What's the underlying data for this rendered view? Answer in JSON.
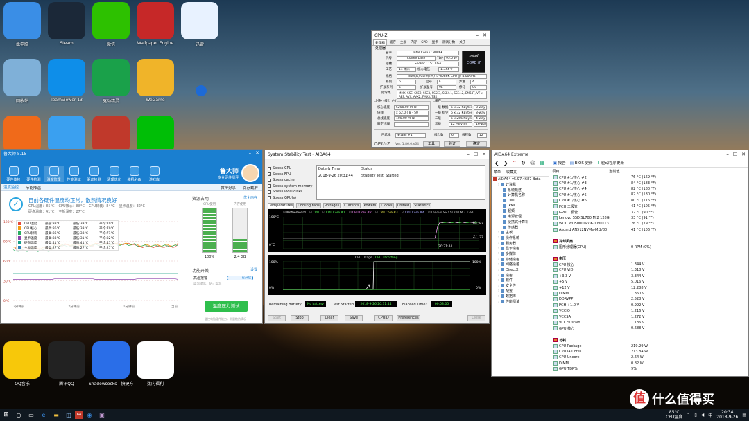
{
  "desktop": {
    "icons": [
      {
        "label": "此电脑",
        "icon": "computer-icon",
        "color": "#3a8ee6"
      },
      {
        "label": "Steam",
        "icon": "steam-icon",
        "color": "#1b2838"
      },
      {
        "label": "微信",
        "icon": "wechat-icon",
        "color": "#2dc100"
      },
      {
        "label": "Wallpaper Engine",
        "icon": "wallpaper-engine-icon",
        "color": "#c62828"
      },
      {
        "label": "迅雷",
        "icon": "xunlei-icon",
        "color": "#e8f2ff"
      },
      {
        "label": "回收站",
        "icon": "recycle-bin-icon",
        "color": "#7fb0d8"
      },
      {
        "label": "TeamViewer 13",
        "icon": "teamviewer-icon",
        "color": "#0e8ee9"
      },
      {
        "label": "驱动精灵",
        "icon": "driver-genius-icon",
        "color": "#1aa14a"
      },
      {
        "label": "WeGame",
        "icon": "wegame-icon",
        "color": "#f0b429"
      },
      {
        "label": "",
        "icon": "app-icon",
        "color": "#1d6ad6"
      },
      {
        "label": "",
        "icon": "layers-icon",
        "color": "#f06a1a"
      },
      {
        "label": "",
        "icon": "qq-browser-icon",
        "color": "#3aa0f0"
      },
      {
        "label": "",
        "icon": "aida64-icon",
        "color": "#c0392b"
      },
      {
        "label": "",
        "icon": "iqiyi-icon",
        "color": "#00be06"
      },
      {
        "label": "QQ音乐",
        "icon": "qqmusic-icon",
        "color": "#f7c80a"
      },
      {
        "label": "腾讯QQ",
        "icon": "qq-icon",
        "color": "#222"
      },
      {
        "label": "Shadowsocks - 快捷方式",
        "icon": "shadowsocks-icon",
        "color": "#2a6ee8"
      },
      {
        "label": "数内福利",
        "icon": "document-icon",
        "color": "#ffffff"
      }
    ]
  },
  "ludashi": {
    "title": "鲁大师 5.15",
    "tools": [
      "硬件体检",
      "硬件检测",
      "温度管理",
      "性能测试",
      "驱动检测",
      "清理优化",
      "装机必备",
      "游戏库"
    ],
    "brand": "鲁大师",
    "brand_sub": "专业硬件测评",
    "tabs": [
      "温度监控",
      "节能降温"
    ],
    "right_links": [
      "微博分享",
      "保存截屏"
    ],
    "status": "目前各硬件温度均正常，散热情况良好",
    "summary": [
      "CPU温度：85°C",
      "CPU核心：88°C",
      "CPU封装：84°C",
      "显卡温度：32°C",
      "硬盘温度：41°C",
      "主板温度：27°C"
    ],
    "legend": [
      {
        "name": "CPU温度",
        "cur": "最低:38°C",
        "min": "最低:33°C",
        "avg": "平均:70°C",
        "color": "#e74c3c"
      },
      {
        "name": "CPU核心",
        "cur": "最高:86°C",
        "min": "最低:33°C",
        "avg": "平均:70°C",
        "color": "#f39c12"
      },
      {
        "name": "CPU封装",
        "cur": "最高:86°C",
        "min": "最低:33°C",
        "avg": "平均:71°C",
        "color": "#27ae60"
      },
      {
        "name": "显卡温度",
        "cur": "最高:33°C",
        "min": "最低:31°C",
        "avg": "平均:32°C",
        "color": "#8e44ad"
      },
      {
        "name": "硬盘温度",
        "cur": "最高:41°C",
        "min": "最低:41°C",
        "avg": "平均:41°C",
        "color": "#16a085"
      },
      {
        "name": "主板温度",
        "cur": "最高:27°C",
        "min": "最低:27°C",
        "avg": "平均:27°C",
        "color": "#2980b9"
      }
    ],
    "yticks": [
      "120°C",
      "90°C",
      "60°C",
      "30°C",
      "0°C"
    ],
    "xticks": [
      "3分钟前",
      "2分钟前",
      "1分钟前",
      "当前"
    ],
    "resource_title": "资源占用",
    "resource_link": "优化内存",
    "cpu_label": "CPU使用",
    "mem_label": "内存使用",
    "cpu_value": "100%",
    "mem_value": "2.4 GB",
    "cpu_fill": 1.0,
    "mem_fill": 0.3,
    "func_title": "功能开关",
    "func_link": "设置",
    "alarm_label": "高温报警",
    "alarm_sub": "高温提示，防止高温",
    "alarm_state": "已开启",
    "stress_button": "温度压力测试",
    "footer": "监控电脑硬件能力，测量散热情况"
  },
  "aida_stress": {
    "title": "System Stability Test - AIDA64",
    "checks": [
      {
        "l": "Stress CPU",
        "c": false
      },
      {
        "l": "Stress FPU",
        "c": true
      },
      {
        "l": "Stress cache",
        "c": false
      },
      {
        "l": "Stress system memory",
        "c": false
      },
      {
        "l": "Stress local disks",
        "c": false
      },
      {
        "l": "Stress GPU(s)",
        "c": false
      }
    ],
    "col_date": "Date & Time",
    "col_status": "Status",
    "log_date": "2018-9-26 20:31:44",
    "log_status": "Stability Test: Started",
    "tabs": [
      "Temperatures",
      "Cooling Fans",
      "Voltages",
      "Currents",
      "Powers",
      "Clocks",
      "Unified",
      "Statistics"
    ],
    "temp_legend": [
      "Motherboard",
      "CPU",
      "CPU Core #1",
      "CPU Core #2",
      "CPU Core #3",
      "CPU Core #4",
      "Lenovo SSD SL700 M.2 128G"
    ],
    "temp_top": "100°C",
    "temp_bottom": "0°C",
    "temp_time": "20:31:44",
    "temp_vals": [
      "83",
      "82",
      "27",
      "33"
    ],
    "usage_title": "CPU Usage",
    "throttle_title": "CPU Throttling",
    "usage_top": "100%",
    "usage_bottom": "0%",
    "usage_right_top": "100%",
    "usage_right_bottom": "0%",
    "battery_label": "Remaining Battery:",
    "battery_value": "No battery",
    "started_label": "Test Started:",
    "started_value": "2018-9-26 20:31:44",
    "elapsed_label": "Elapsed Time:",
    "elapsed_value": "00:03:05",
    "buttons": [
      "Start",
      "Stop",
      "Clear",
      "Save",
      "CPUID",
      "Preferences",
      "Close"
    ]
  },
  "cpuz": {
    "title": "CPU-Z",
    "tabs": [
      "处理器",
      "缓存",
      "主板",
      "内存",
      "SPD",
      "显卡",
      "测试分数",
      "关于"
    ],
    "section": "处理器",
    "name_l": "名字",
    "name": "Intel Core i7 8086K",
    "code_l": "代号",
    "code": "Coffee Lake",
    "tdp_l": "TDP",
    "tdp": "95.0 W",
    "socket_l": "插槽",
    "socket": "Socket 1151 LGA",
    "tech_l": "工艺",
    "tech": "14 纳米",
    "volt_l": "核心电压",
    "volt": "1.344 V",
    "spec_l": "规格",
    "spec": "Intel(R) Core(TM) i7-8086K CPU @ 4.00GHz",
    "family_l": "系列",
    "family": "6",
    "model_l": "型号",
    "model": "E",
    "step_l": "步进",
    "step": "A",
    "extfam_l": "扩展系列",
    "extfam": "6",
    "extmodel_l": "扩展型号",
    "extmodel": "9E",
    "rev_l": "修订",
    "rev": "U0",
    "inst_l": "指令集",
    "inst": "MMX, SSE, SSE2, SSE3, SSSE3, SSE4.1, SSE4.2, EM64T, VT-x, AES, AVX, AVX2, FMA3, TSX",
    "clock_title": "时钟 (核心 #0)",
    "cache_title": "缓存",
    "core_speed_l": "核心速度",
    "core_speed": "5200.00 MHz",
    "mult_l": "倍频",
    "mult": "x 52.0 ( 8 - 50 )",
    "bus_l": "总线速度",
    "bus": "100.00 MHz",
    "fsb_l": "额定 FSB",
    "fsb": "",
    "l1d_l": "一级 数据",
    "l1d": "6 x 32 KBytes",
    "l1d_w": "8-way",
    "l1i_l": "一级 指令",
    "l1i": "6 x 32 KBytes",
    "l1i_w": "8-way",
    "l2_l": "二级",
    "l2": "6 x 256 KBytes",
    "l2_w": "4-way",
    "l3_l": "三级",
    "l3": "12 MBytes",
    "l3_w": "16-way",
    "sel_l": "已选择",
    "sel": "处理器 #1",
    "cores_l": "核心数",
    "cores": "6",
    "threads_l": "线程数",
    "threads": "12",
    "brand": "CPU-Z",
    "ver": "Ver. 1.86.0.x64",
    "btns": [
      "工具",
      "验证",
      "确定"
    ],
    "badge_top": "intel",
    "badge_bottom": "CORE i7"
  },
  "aida_ext": {
    "title": "AIDA64 Extreme",
    "toolbar": [
      "报告",
      "BIOS 更新",
      "驱动程序更新"
    ],
    "menu_l": "菜单",
    "fav_l": "收藏夹",
    "col_item": "项目",
    "col_value": "当前值",
    "tree": [
      {
        "t": "AIDA64 v5.97.4687 Beta",
        "lvl": 0
      },
      {
        "t": "计算机",
        "lvl": 1
      },
      {
        "t": "系统概述",
        "lvl": 2
      },
      {
        "t": "计算机名称",
        "lvl": 2
      },
      {
        "t": "DMI",
        "lvl": 2
      },
      {
        "t": "IPMI",
        "lvl": 2
      },
      {
        "t": "超频",
        "lvl": 2
      },
      {
        "t": "电源管理",
        "lvl": 2
      },
      {
        "t": "便携式计算机",
        "lvl": 2
      },
      {
        "t": "传感器",
        "lvl": 2
      },
      {
        "t": "主板",
        "lvl": 1
      },
      {
        "t": "操作系统",
        "lvl": 1
      },
      {
        "t": "服务器",
        "lvl": 1
      },
      {
        "t": "显示设备",
        "lvl": 1
      },
      {
        "t": "多媒体",
        "lvl": 1
      },
      {
        "t": "存储设备",
        "lvl": 1
      },
      {
        "t": "网络设备",
        "lvl": 1
      },
      {
        "t": "DirectX",
        "lvl": 1
      },
      {
        "t": "设备",
        "lvl": 1
      },
      {
        "t": "软件",
        "lvl": 1
      },
      {
        "t": "安全性",
        "lvl": 1
      },
      {
        "t": "配置",
        "lvl": 1
      },
      {
        "t": "数据库",
        "lvl": 1
      },
      {
        "t": "性能测试",
        "lvl": 1
      }
    ],
    "rows": [
      {
        "k": "CPU #1/核心 #2",
        "v": "76 °C (169 °F)"
      },
      {
        "k": "CPU #1/核心 #3",
        "v": "84 °C (183 °F)"
      },
      {
        "k": "CPU #1/核心 #4",
        "v": "82 °C (180 °F)"
      },
      {
        "k": "CPU #1/核心 #5",
        "v": "82 °C (180 °F)"
      },
      {
        "k": "CPU #1/核心 #6",
        "v": "80 °C (176 °F)"
      },
      {
        "k": "PCH 二极管",
        "v": "41 °C (105 °F)"
      },
      {
        "k": "GPU 二极管",
        "v": "32 °C (90 °F)"
      },
      {
        "k": "Lenovo SSD SL700 M.2 128G",
        "v": "33 °C (91 °F)"
      },
      {
        "k": "WDC WD5000LPVX-00V0TT3",
        "v": "26 °C (79 °F)"
      },
      {
        "k": "Asgard AN512NVMe-M.2/80",
        "v": "41 °C (106 °F)"
      },
      {
        "k": "",
        "v": ""
      },
      {
        "k": "冷却风扇",
        "v": "",
        "h": true
      },
      {
        "k": "图形处理器(GPU)",
        "v": "0 RPM  (0%)"
      },
      {
        "k": "",
        "v": ""
      },
      {
        "k": "电压",
        "v": "",
        "h": true
      },
      {
        "k": "CPU 核心",
        "v": "1.344 V"
      },
      {
        "k": "CPU VID",
        "v": "1.318 V"
      },
      {
        "k": "+3.3 V",
        "v": "3.344 V"
      },
      {
        "k": "+5 V",
        "v": "5.016 V"
      },
      {
        "k": "+12 V",
        "v": "12.288 V"
      },
      {
        "k": "DIMM",
        "v": "1.360 V"
      },
      {
        "k": "DDRVPP",
        "v": "2.528 V"
      },
      {
        "k": "PCH +1.0 V",
        "v": "0.992 V"
      },
      {
        "k": "VCCIO",
        "v": "1.216 V"
      },
      {
        "k": "VCCSA",
        "v": "1.272 V"
      },
      {
        "k": "VCC Sustain",
        "v": "1.136 V"
      },
      {
        "k": "GPU 核心",
        "v": "0.688 V"
      },
      {
        "k": "",
        "v": ""
      },
      {
        "k": "功耗",
        "v": "",
        "h": true
      },
      {
        "k": "CPU Package",
        "v": "219.29 W"
      },
      {
        "k": "CPU IA Cores",
        "v": "213.84 W"
      },
      {
        "k": "CPU Uncore",
        "v": "2.64 W"
      },
      {
        "k": "DIMM",
        "v": "0.82 W"
      },
      {
        "k": "GPU TDP%",
        "v": "9%"
      }
    ]
  },
  "taskbar": {
    "temp": "85°C",
    "temp_label": "CPU温度",
    "time": "20:34",
    "date": "2018-9-26",
    "ime": "中",
    "watermark": "什么值得买"
  }
}
